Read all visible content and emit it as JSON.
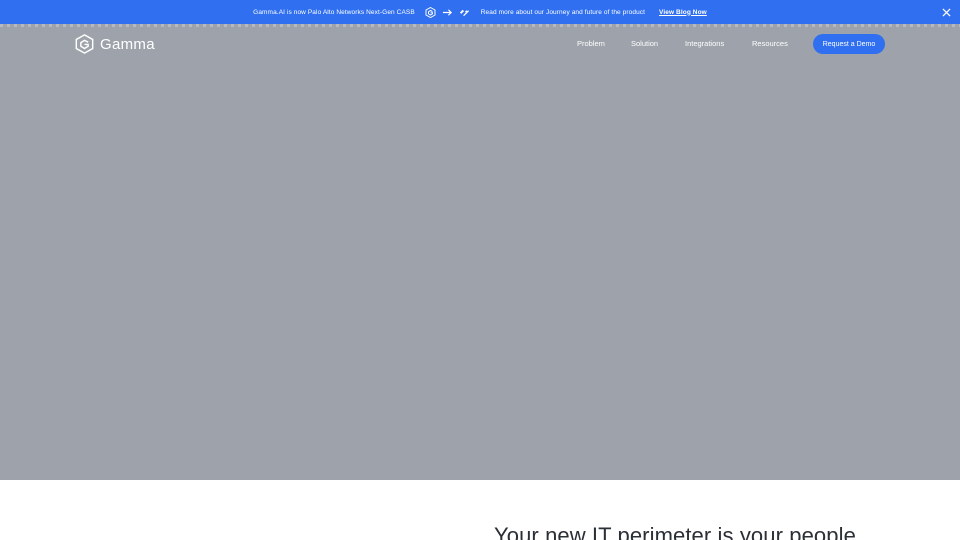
{
  "announcement": {
    "text": "Gamma.AI is now Palo Alto Networks Next-Gen CASB",
    "read_more": "Read more about our Journey and future of the product",
    "link_label": "View Blog Now",
    "icons": [
      "gamma-logo-icon",
      "arrow-right-icon",
      "palo-alto-logo-icon",
      "close-icon"
    ]
  },
  "nav": {
    "brand": "Gamma",
    "items": [
      {
        "label": "Problem"
      },
      {
        "label": "Solution"
      },
      {
        "label": "Integrations"
      },
      {
        "label": "Resources"
      }
    ],
    "cta_label": "Request a Demo"
  },
  "section": {
    "headline": "Your new IT perimeter is your people"
  },
  "colors": {
    "accent": "#2f6ff0",
    "hero_overlay": "#9ea3ab",
    "text_dark": "#2b2f36"
  }
}
